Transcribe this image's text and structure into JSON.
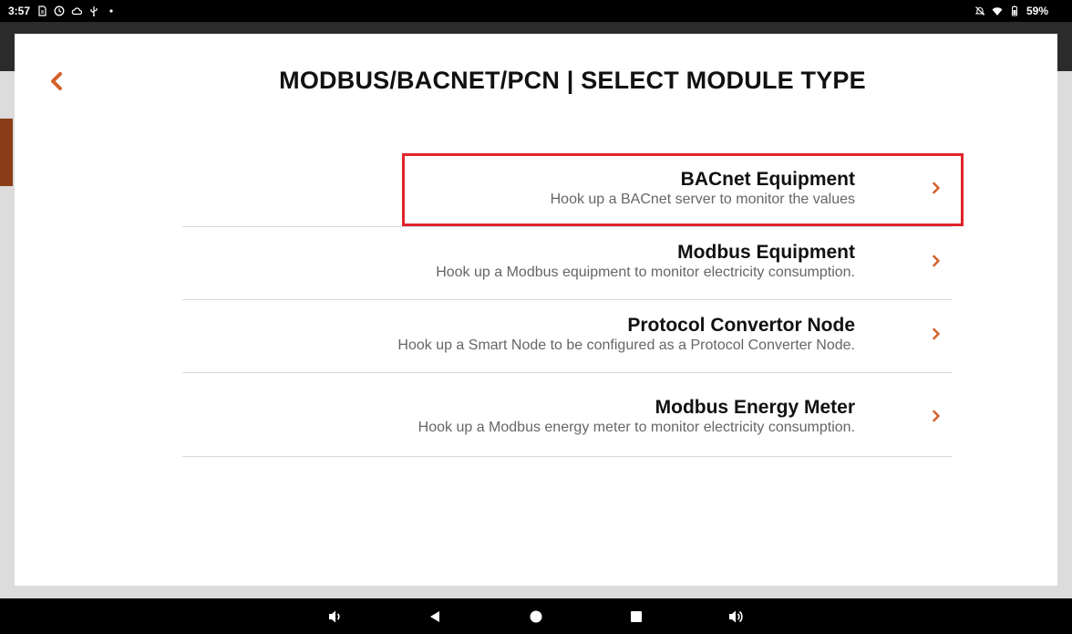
{
  "status_bar": {
    "time": "3:57",
    "battery": "59%",
    "left_icons": [
      "sim-icon",
      "clock-icon",
      "cloud-icon",
      "usb-icon",
      "dot-icon"
    ],
    "right_icons": [
      "mute-icon",
      "wifi-icon",
      "battery-icon"
    ]
  },
  "dialog": {
    "title": "MODBUS/BACNET/PCN | SELECT MODULE TYPE",
    "back_icon": "chevron-left-icon"
  },
  "options": [
    {
      "title": "BACnet Equipment",
      "subtitle": "Hook up a BACnet server to monitor the values",
      "highlighted": true
    },
    {
      "title": "Modbus Equipment",
      "subtitle": "Hook up a Modbus equipment to monitor electricity consumption."
    },
    {
      "title": "Protocol Convertor Node",
      "subtitle": "Hook up a Smart Node to be configured as a Protocol Converter Node."
    },
    {
      "title": "Modbus Energy Meter",
      "subtitle": "Hook up a Modbus energy meter to monitor electricity consumption."
    }
  ],
  "nav_bar": {
    "buttons": [
      "volume-down-icon",
      "back-triangle-icon",
      "home-circle-icon",
      "recents-square-icon",
      "volume-up-icon"
    ]
  },
  "colors": {
    "accent": "#d4622a",
    "highlight": "#e0242b",
    "title_text": "#111111",
    "subtitle_text": "#666666"
  }
}
